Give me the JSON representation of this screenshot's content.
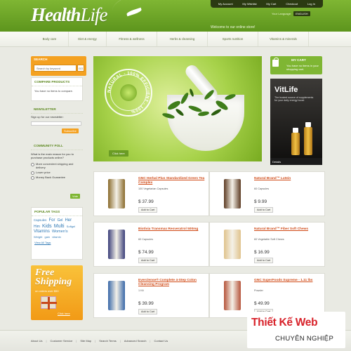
{
  "header": {
    "logo_health": "Health",
    "logo_life": "Life",
    "top_links": [
      "My Account",
      "My Wishlist",
      "My Cart",
      "Checkout",
      "Log In"
    ],
    "language_label": "Your Language:",
    "language_value": "ENGLISH",
    "welcome": "Welcome to our online store!"
  },
  "nav": {
    "items": [
      "Body care",
      "Diet & energy",
      "Fitness & wellness",
      "Herbs & cleansing",
      "Sports nutrition",
      "Vitamins & minerals"
    ]
  },
  "sidebar": {
    "search_title": "SEARCH",
    "search_value": "Search by keyword",
    "search_go": "GO",
    "compare_title": "COMPARE PRODUCTS",
    "compare_text": "You have no items to compare.",
    "newsletter_title": "NEWSLETTER",
    "newsletter_label": "Sign up for our newsletter:",
    "newsletter_button": "Subscribe",
    "poll_title": "COMMUNITY POLL",
    "poll_question": "What is the main reason for you to purchase products online?",
    "poll_options": [
      "More convenient shipping and delivery",
      "Lower price",
      "Money Back Guarantee"
    ],
    "poll_vote": "Vote",
    "tags_title": "POPULAR TAGS",
    "tags": [
      "Capsules",
      "For",
      "Gel",
      "Her",
      "Him",
      "Kids",
      "Multi",
      "Softgel",
      "Vitamins",
      "Women's",
      "Weight",
      "gain",
      "vitamin"
    ],
    "tags_viewall": "View All Tags",
    "promo_free": "Free",
    "promo_shipping": "Shipping",
    "promo_sub": "on orders over $50",
    "promo_cta": "Click here"
  },
  "slider": {
    "badge_text": "NATURAL - 100% EFFICIENT - 100%",
    "cta": "Click here"
  },
  "cart": {
    "title": "MY CART",
    "text": "You have no items in your shopping cart."
  },
  "ad": {
    "title": "VitLife",
    "sub": "The trusted source of supplements for your daily energy boost",
    "bar": "Details"
  },
  "products": [
    {
      "name": "GNC Herbal Plus Standardized Green Tea Complex",
      "desc": "100 Vegetarian Capsules",
      "price": "$ 37.99",
      "add": "Add to Cart",
      "color": "#8a6b2c"
    },
    {
      "name": "Natural Brand™ Lutein",
      "desc": "60 Capsules",
      "price": "$ 9.99",
      "add": "Add to Cart",
      "color": "#5c3a22"
    },
    {
      "name": "Biotivia Transmax Resveratrol 500mg",
      "desc": "60 Capsules",
      "price": "$ 74.99",
      "add": "Add to Cart",
      "color": "#3b3f7a"
    },
    {
      "name": "Natural Brand™ Fiber Soft Chews",
      "desc": "60 Vegetable Soft Chews",
      "price": "$ 16.99",
      "add": "Add to Cart",
      "color": "#e0c38c"
    },
    {
      "name": "Everclense® Complete 4-Step Colon Cleansing Program",
      "desc": "1 Kit",
      "price": "$ 39.99",
      "add": "Add to Cart",
      "color": "#3968a8"
    },
    {
      "name": "GNC SuperFoods Supreme - 1.11 lbs",
      "desc": "Powder",
      "price": "$ 49.99",
      "add": "Add to Cart",
      "color": "#b5533a"
    }
  ],
  "footer": {
    "links": [
      "About Us",
      "Customer Service",
      "Site Map",
      "Search Terms",
      "Advanced Search",
      "Contact Us"
    ]
  },
  "watermark": {
    "line1": "Thiết Kế Web",
    "line2": "CHUYÊN NGHIỆP"
  },
  "colors": {
    "brand_green": "#6fa526",
    "accent_orange": "#f4a121",
    "link_red": "#d04a16"
  }
}
